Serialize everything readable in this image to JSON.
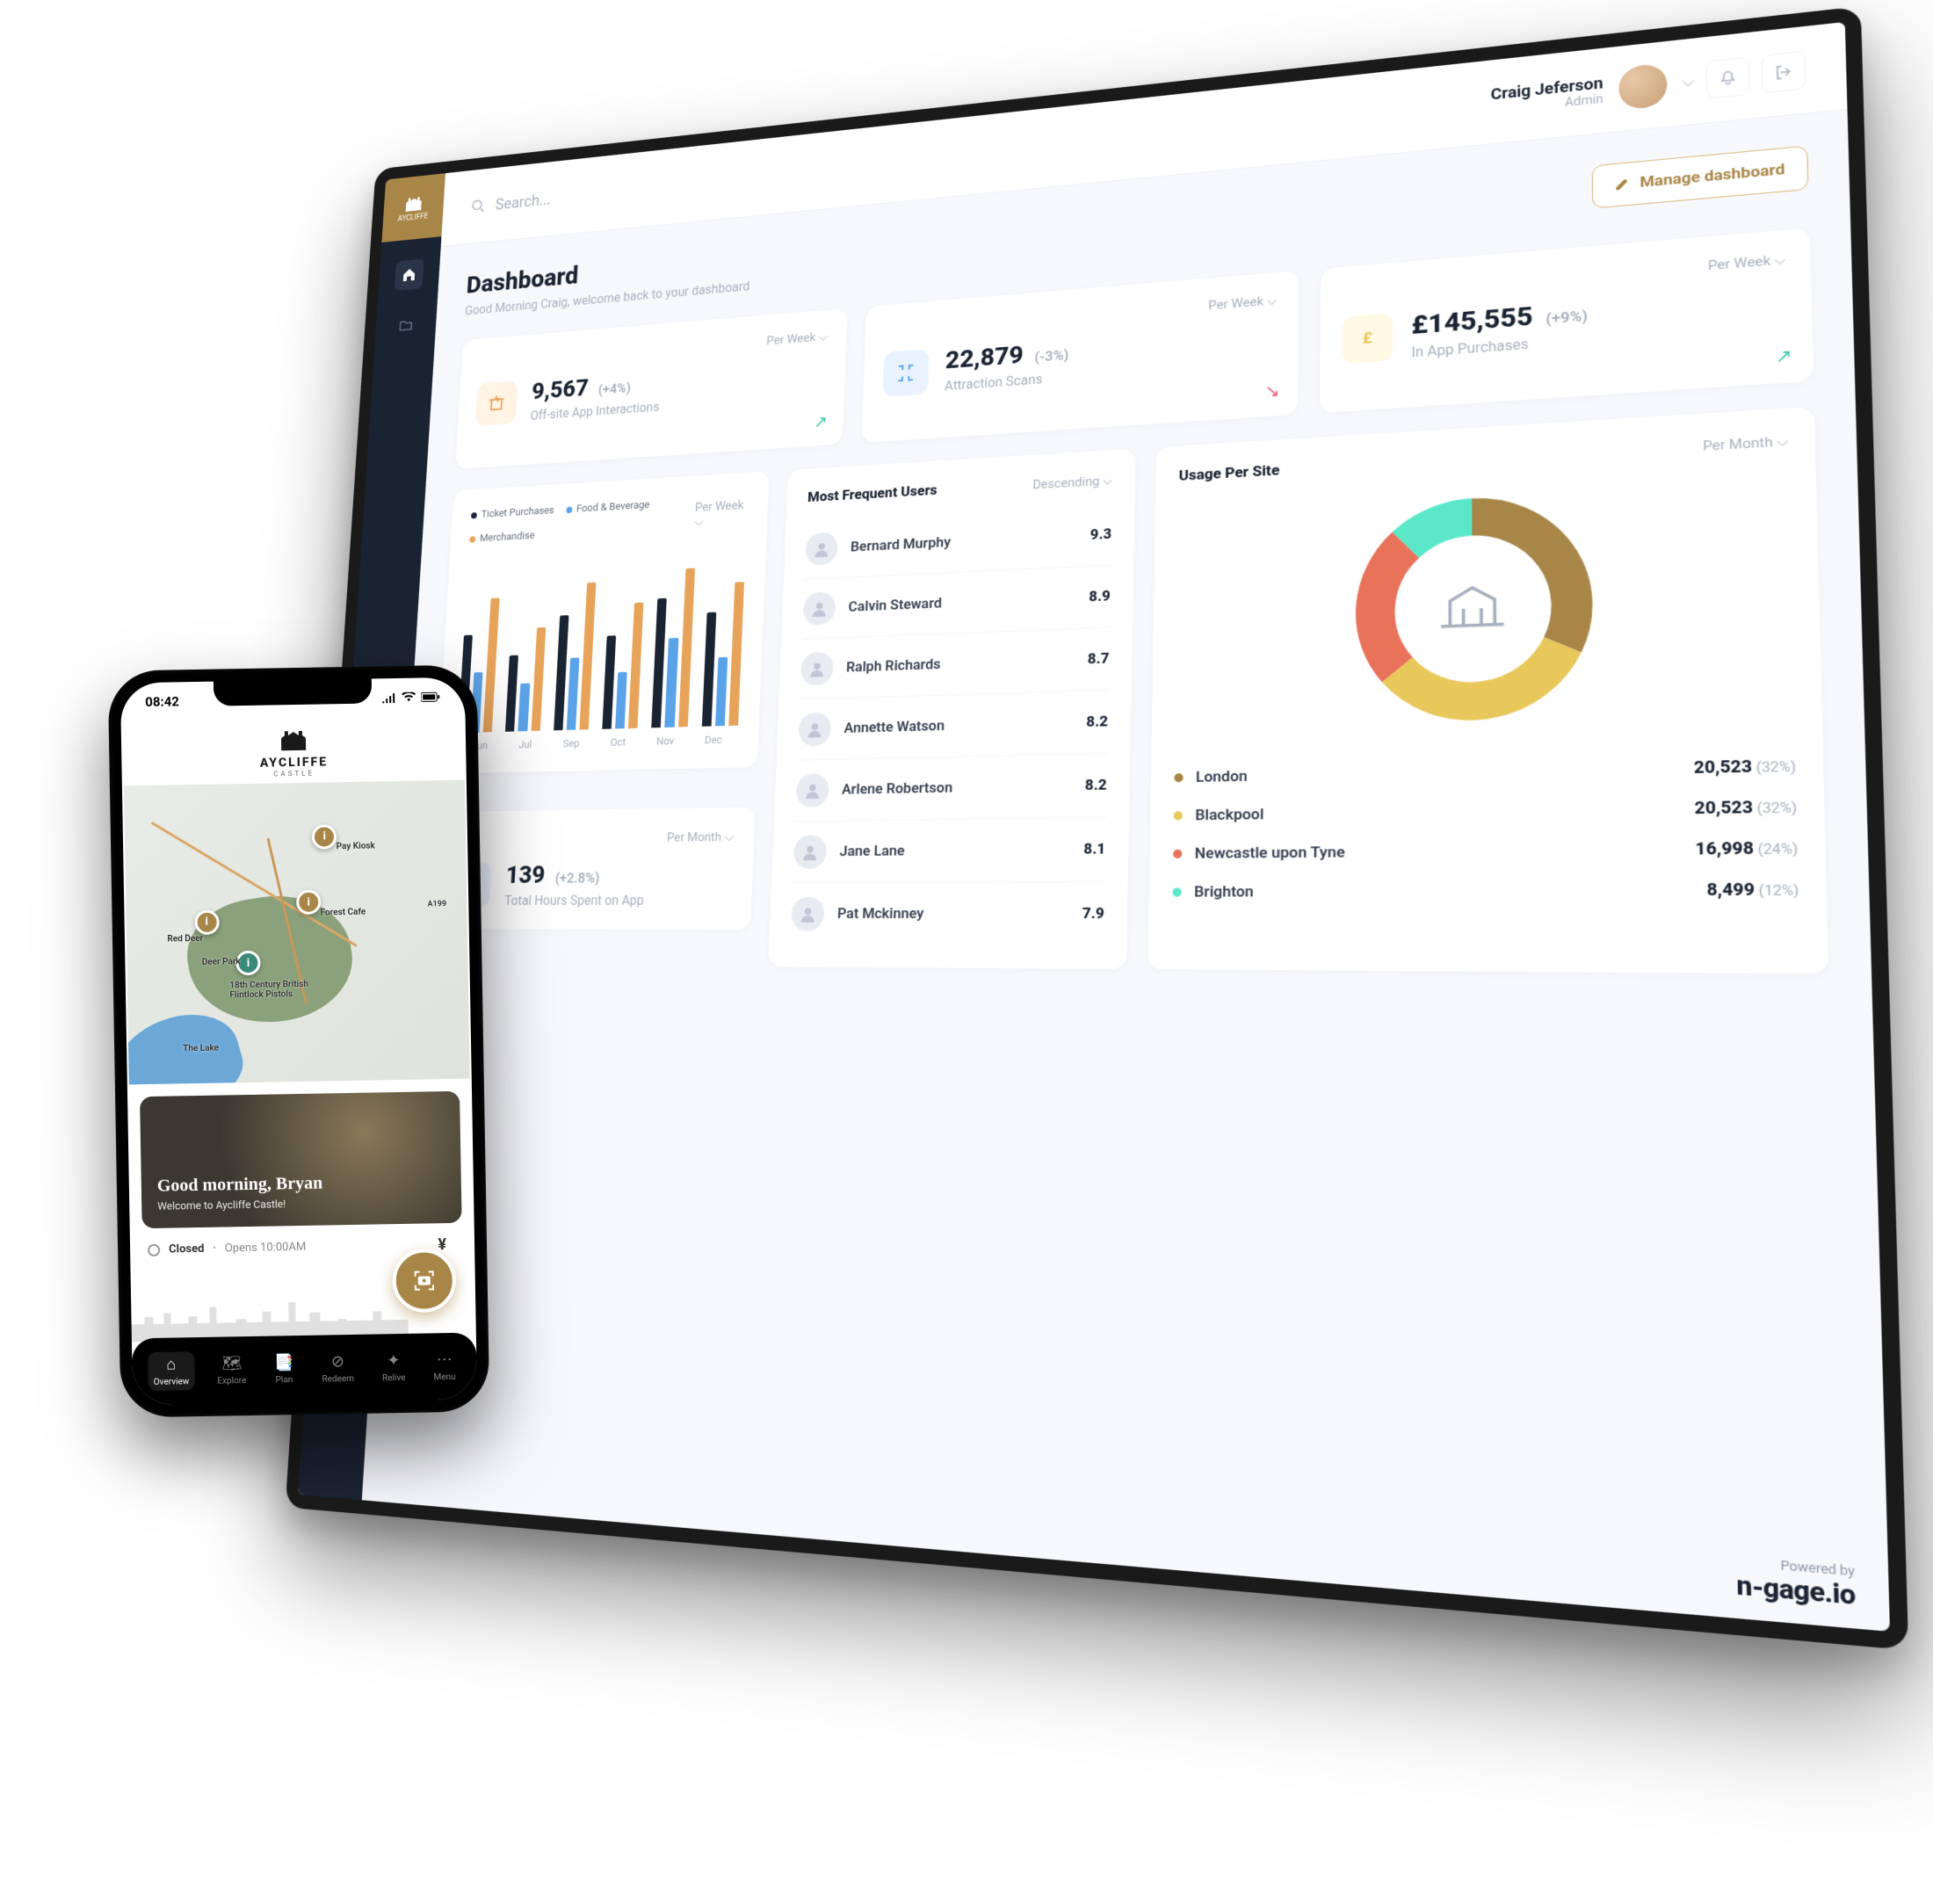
{
  "brand": {
    "name": "AYCLIFFE",
    "sub": "CASTLE"
  },
  "header": {
    "search_placeholder": "Search...",
    "user_name": "Craig Jeferson",
    "user_role": "Admin"
  },
  "dashboard": {
    "title": "Dashboard",
    "subtitle": "Good Morning Craig, welcome back to your dashboard",
    "manage_btn": "Manage dashboard"
  },
  "kpis": [
    {
      "value": "9,567",
      "delta": "(+4%)",
      "label": "Off-site App Interactions",
      "period": "Per Week",
      "icon_bg": "#fff3e6",
      "icon_color": "#e8a35a",
      "trend": "up"
    },
    {
      "value": "22,879",
      "delta": "(-3%)",
      "label": "Attraction Scans",
      "period": "Per Week",
      "icon_bg": "#e8f3ff",
      "icon_color": "#5aa3e8",
      "trend": "down"
    },
    {
      "value": "£145,555",
      "delta": "(+9%)",
      "label": "In App Purchases",
      "period": "Per Week",
      "icon_bg": "#fff9e6",
      "icon_color": "#e8c85a",
      "trend": "up"
    }
  ],
  "barPanel": {
    "legend": [
      {
        "label": "Ticket Purchases",
        "c": "#1a2332"
      },
      {
        "label": "Food & Beverage",
        "c": "#5aa3e8"
      },
      {
        "label": "Merchandise",
        "c": "#e8a35a"
      }
    ],
    "period": "Per Week"
  },
  "chart_data": {
    "type": "bar",
    "categories": [
      "Jun",
      "Jul",
      "Sep",
      "Oct",
      "Nov",
      "Dec"
    ],
    "series": [
      {
        "name": "Ticket Purchases",
        "values": [
          62,
          48,
          72,
          58,
          80,
          70
        ]
      },
      {
        "name": "Food & Beverage",
        "values": [
          38,
          30,
          45,
          35,
          55,
          42
        ]
      },
      {
        "name": "Merchandise",
        "values": [
          85,
          65,
          92,
          78,
          98,
          88
        ]
      }
    ],
    "ylim": [
      0,
      100
    ]
  },
  "hours": {
    "period": "Per Month",
    "value": "139",
    "delta": "(+2.8%)",
    "label": "Total Hours Spent on App"
  },
  "users": {
    "title": "Most Frequent Users",
    "sort": "Descending",
    "list": [
      {
        "name": "Bernard Murphy",
        "score": "9.3"
      },
      {
        "name": "Calvin Steward",
        "score": "8.9"
      },
      {
        "name": "Ralph Richards",
        "score": "8.7"
      },
      {
        "name": "Annette Watson",
        "score": "8.2"
      },
      {
        "name": "Arlene Robertson",
        "score": "8.2"
      },
      {
        "name": "Jane Lane",
        "score": "8.1"
      },
      {
        "name": "Pat Mckinney",
        "score": "7.9"
      }
    ]
  },
  "sites": {
    "title": "Usage Per Site",
    "period": "Per Month",
    "list": [
      {
        "name": "London",
        "value": "20,523",
        "pct": "(32%)",
        "c": "#a88648"
      },
      {
        "name": "Blackpool",
        "value": "20,523",
        "pct": "(32%)",
        "c": "#e8c85a"
      },
      {
        "name": "Newcastle upon Tyne",
        "value": "16,998",
        "pct": "(24%)",
        "c": "#e8735a"
      },
      {
        "name": "Brighton",
        "value": "8,499",
        "pct": "(12%)",
        "c": "#5ae8c8"
      }
    ],
    "donut_remainder_c": "#1a2332"
  },
  "footer": {
    "p": "Powered by",
    "b": "n-gage.io"
  },
  "phone": {
    "time": "08:42",
    "map_labels": {
      "pay": "Pay Kiosk",
      "forest": "Forest Cafe",
      "red": "Red Deer",
      "deer": "Deer Park",
      "pistols": "18th Century British Flintlock Pistols",
      "lake": "The Lake",
      "road": "A199"
    },
    "greeting": "Good morning, Bryan",
    "welcome": "Welcome to Aycliffe Castle!",
    "status_closed": "Closed",
    "status_opens": "Opens 10:00AM",
    "nav": [
      "Overview",
      "Explore",
      "Plan",
      "Redeem",
      "Relive",
      "Menu"
    ]
  }
}
